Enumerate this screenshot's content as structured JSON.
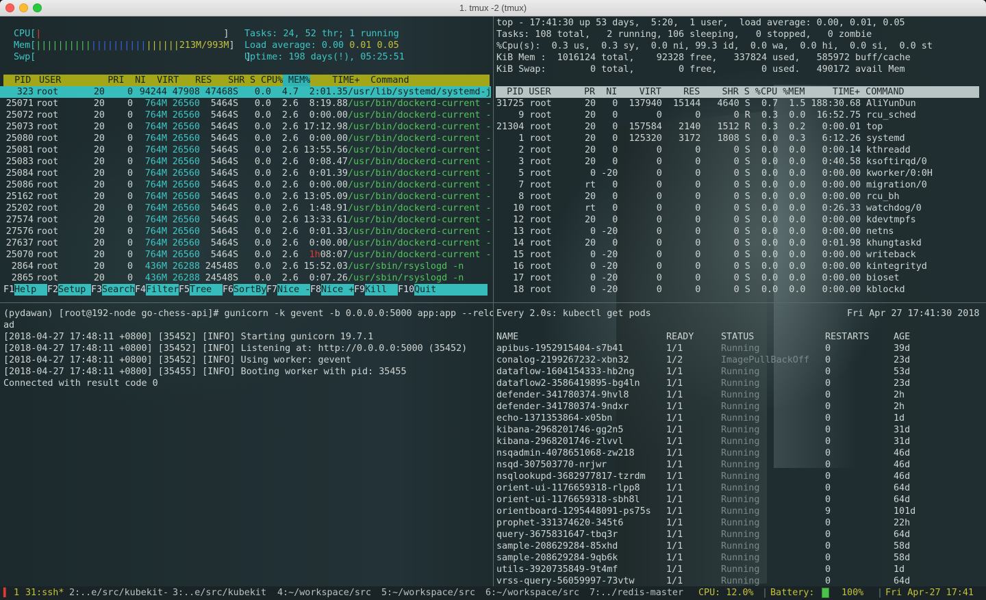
{
  "window": {
    "title": "1. tmux -2 (tmux)"
  },
  "htop": {
    "meter_cpu_label": "CPU[",
    "meter_cpu_bar": "|",
    "meter_cpu_end": "                                 ]",
    "meter_mem_label": "Mem[",
    "meter_mem_bar1": "||||||||||",
    "meter_mem_bar2": "||||||||||",
    "meter_mem_bar3": "||||||",
    "meter_mem_value": "213M/993M",
    "meter_mem_end": "]",
    "meter_swp_label": "Swp[",
    "meter_swp_end": "                                      ]",
    "tasks_label": "Tasks: ",
    "tasks_value": "24, 52 thr; 1 running",
    "load_label": "Load average: ",
    "load_1": "0.00",
    "load_5": "0.01",
    "load_15": "0.05",
    "uptime_label": "Uptime: ",
    "uptime_value": "198 days(!), 05:25:51",
    "columns": [
      {
        "text": "  PID",
        "w": 44
      },
      {
        "text": " USER",
        "w": 60
      },
      {
        "text": "      PRI",
        "w": 72
      },
      {
        "text": "  NI",
        "w": 32
      },
      {
        "text": "  VIRT",
        "w": 48
      },
      {
        "text": "   RES",
        "w": 48
      },
      {
        "text": "   SHR",
        "w": 48
      },
      {
        "text": " S",
        "w": 16
      },
      {
        "text": " CPU%",
        "w": 40
      },
      {
        "text": " MEM%",
        "w": 40
      },
      {
        "text": "    TIME+",
        "w": 72
      },
      {
        "text": "  Command",
        "w": 190
      }
    ],
    "rows": [
      {
        "pid": "  323",
        "user": "root",
        "pri": "20",
        "ni": "0",
        "virt": "94244",
        "res": "47908",
        "shr": "47468",
        "s": "S",
        "cpu": "0.0",
        "mem": "4.7",
        "time_h": "",
        "time": "2:01.35",
        "cmd": "/usr/lib/systemd/systemd-j",
        "sel": true
      },
      {
        "pid": "25071",
        "user": "root",
        "pri": "20",
        "ni": "0",
        "virt": "764M",
        "res": "26560",
        "shr": "5464",
        "s": "S",
        "cpu": "0.0",
        "mem": "2.6",
        "time_h": "",
        "time": "8:19.88",
        "cmd": "/usr/bin/dockerd-current -"
      },
      {
        "pid": "25072",
        "user": "root",
        "pri": "20",
        "ni": "0",
        "virt": "764M",
        "res": "26560",
        "shr": "5464",
        "s": "S",
        "cpu": "0.0",
        "mem": "2.6",
        "time_h": "",
        "time": "0:00.00",
        "cmd": "/usr/bin/dockerd-current -"
      },
      {
        "pid": "25073",
        "user": "root",
        "pri": "20",
        "ni": "0",
        "virt": "764M",
        "res": "26560",
        "shr": "5464",
        "s": "S",
        "cpu": "0.0",
        "mem": "2.6",
        "time_h": "",
        "time": "17:12.98",
        "cmd": "/usr/bin/dockerd-current -"
      },
      {
        "pid": "25080",
        "user": "root",
        "pri": "20",
        "ni": "0",
        "virt": "764M",
        "res": "26560",
        "shr": "5464",
        "s": "S",
        "cpu": "0.0",
        "mem": "2.6",
        "time_h": "",
        "time": "0:00.00",
        "cmd": "/usr/bin/dockerd-current -"
      },
      {
        "pid": "25081",
        "user": "root",
        "pri": "20",
        "ni": "0",
        "virt": "764M",
        "res": "26560",
        "shr": "5464",
        "s": "S",
        "cpu": "0.0",
        "mem": "2.6",
        "time_h": "",
        "time": "13:55.56",
        "cmd": "/usr/bin/dockerd-current -"
      },
      {
        "pid": "25083",
        "user": "root",
        "pri": "20",
        "ni": "0",
        "virt": "764M",
        "res": "26560",
        "shr": "5464",
        "s": "S",
        "cpu": "0.0",
        "mem": "2.6",
        "time_h": "",
        "time": "0:08.47",
        "cmd": "/usr/bin/dockerd-current -"
      },
      {
        "pid": "25084",
        "user": "root",
        "pri": "20",
        "ni": "0",
        "virt": "764M",
        "res": "26560",
        "shr": "5464",
        "s": "S",
        "cpu": "0.0",
        "mem": "2.6",
        "time_h": "",
        "time": "0:01.39",
        "cmd": "/usr/bin/dockerd-current -"
      },
      {
        "pid": "25086",
        "user": "root",
        "pri": "20",
        "ni": "0",
        "virt": "764M",
        "res": "26560",
        "shr": "5464",
        "s": "S",
        "cpu": "0.0",
        "mem": "2.6",
        "time_h": "",
        "time": "0:00.00",
        "cmd": "/usr/bin/dockerd-current -"
      },
      {
        "pid": "25162",
        "user": "root",
        "pri": "20",
        "ni": "0",
        "virt": "764M",
        "res": "26560",
        "shr": "5464",
        "s": "S",
        "cpu": "0.0",
        "mem": "2.6",
        "time_h": "",
        "time": "13:05.09",
        "cmd": "/usr/bin/dockerd-current -"
      },
      {
        "pid": "25202",
        "user": "root",
        "pri": "20",
        "ni": "0",
        "virt": "764M",
        "res": "26560",
        "shr": "5464",
        "s": "S",
        "cpu": "0.0",
        "mem": "2.6",
        "time_h": "",
        "time": "1:48.91",
        "cmd": "/usr/bin/dockerd-current -"
      },
      {
        "pid": "27574",
        "user": "root",
        "pri": "20",
        "ni": "0",
        "virt": "764M",
        "res": "26560",
        "shr": "5464",
        "s": "S",
        "cpu": "0.0",
        "mem": "2.6",
        "time_h": "",
        "time": "13:33.61",
        "cmd": "/usr/bin/dockerd-current -"
      },
      {
        "pid": "27576",
        "user": "root",
        "pri": "20",
        "ni": "0",
        "virt": "764M",
        "res": "26560",
        "shr": "5464",
        "s": "S",
        "cpu": "0.0",
        "mem": "2.6",
        "time_h": "",
        "time": "0:01.33",
        "cmd": "/usr/bin/dockerd-current -"
      },
      {
        "pid": "27637",
        "user": "root",
        "pri": "20",
        "ni": "0",
        "virt": "764M",
        "res": "26560",
        "shr": "5464",
        "s": "S",
        "cpu": "0.0",
        "mem": "2.6",
        "time_h": "",
        "time": "0:00.00",
        "cmd": "/usr/bin/dockerd-current -"
      },
      {
        "pid": "25070",
        "user": "root",
        "pri": "20",
        "ni": "0",
        "virt": "764M",
        "res": "26560",
        "shr": "5464",
        "s": "S",
        "cpu": "0.0",
        "mem": "2.6",
        "time_h": "1h",
        "time": "08:07",
        "cmd": "/usr/bin/dockerd-current -"
      },
      {
        "pid": " 2864",
        "user": "root",
        "pri": "20",
        "ni": "0",
        "virt": "436M",
        "res": "26288",
        "shr": "24548",
        "s": "S",
        "cpu": "0.0",
        "mem": "2.6",
        "time_h": "",
        "time": "15:52.03",
        "cmd": "/usr/sbin/rsyslogd -n"
      },
      {
        "pid": " 2865",
        "user": "root",
        "pri": "20",
        "ni": "0",
        "virt": "436M",
        "res": "26288",
        "shr": "24548",
        "s": "S",
        "cpu": "0.0",
        "mem": "2.6",
        "time_h": "",
        "time": "0:07.26",
        "cmd": "/usr/sbin/rsyslogd -n"
      }
    ],
    "fkeys": [
      {
        "key": "F1",
        "label": "Help  "
      },
      {
        "key": "F2",
        "label": "Setup "
      },
      {
        "key": "F3",
        "label": "Search"
      },
      {
        "key": "F4",
        "label": "Filter"
      },
      {
        "key": "F5",
        "label": "Tree  "
      },
      {
        "key": "F6",
        "label": "SortBy"
      },
      {
        "key": "F7",
        "label": "Nice -"
      },
      {
        "key": "F8",
        "label": "Nice +"
      },
      {
        "key": "F9",
        "label": "Kill  "
      },
      {
        "key": "F10",
        "label": "Quit"
      }
    ]
  },
  "top": {
    "summary": [
      "top - 17:41:30 up 53 days,  5:20,  1 user,  load average: 0.00, 0.01, 0.05",
      "Tasks: 108 total,   2 running, 106 sleeping,   0 stopped,   0 zombie",
      "%Cpu(s):  0.3 us,  0.3 sy,  0.0 ni, 99.3 id,  0.0 wa,  0.0 hi,  0.0 si,  0.0 st",
      "KiB Mem :  1016124 total,    92328 free,   337824 used,   585972 buff/cache",
      "KiB Swap:        0 total,        0 free,        0 used.   490172 avail Mem"
    ],
    "header": "  PID USER      PR  NI    VIRT    RES    SHR S %CPU %MEM     TIME+ COMMAND     ",
    "rows": [
      "31725 root      20   0  137940  15144   4640 S  0.7  1.5 188:30.68 AliYunDun",
      "    9 root      20   0       0      0      0 R  0.3  0.0  16:52.75 rcu_sched",
      "21304 root      20   0  157584   2140   1512 R  0.3  0.2   0:00.01 top",
      "    1 root      20   0  125320   3172   1808 S  0.0  0.3   6:12.26 systemd",
      "    2 root      20   0       0      0      0 S  0.0  0.0   0:00.14 kthreadd",
      "    3 root      20   0       0      0      0 S  0.0  0.0   0:40.58 ksoftirqd/0",
      "    5 root       0 -20       0      0      0 S  0.0  0.0   0:00.00 kworker/0:0H",
      "    7 root      rt   0       0      0      0 S  0.0  0.0   0:00.00 migration/0",
      "    8 root      20   0       0      0      0 S  0.0  0.0   0:00.00 rcu_bh",
      "   10 root      rt   0       0      0      0 S  0.0  0.0   0:26.33 watchdog/0",
      "   12 root      20   0       0      0      0 S  0.0  0.0   0:00.00 kdevtmpfs",
      "   13 root       0 -20       0      0      0 S  0.0  0.0   0:00.00 netns",
      "   14 root      20   0       0      0      0 S  0.0  0.0   0:01.98 khungtaskd",
      "   15 root       0 -20       0      0      0 S  0.0  0.0   0:00.00 writeback",
      "   16 root       0 -20       0      0      0 S  0.0  0.0   0:00.00 kintegrityd",
      "   17 root       0 -20       0      0      0 S  0.0  0.0   0:00.00 bioset",
      "   18 root       0 -20       0      0      0 S  0.0  0.0   0:00.00 kblockd"
    ]
  },
  "shell": {
    "prompt": "(pydawan) [root@192-node go-chess-api]# ",
    "command": "gunicorn -k gevent -b 0.0.0.0:5000 app:app --relo",
    "command_wrap": "ad",
    "output": [
      "[2018-04-27 17:48:11 +0800] [35452] [INFO] Starting gunicorn 19.7.1",
      "[2018-04-27 17:48:11 +0800] [35452] [INFO] Listening at: http://0.0.0.0:5000 (35452)",
      "[2018-04-27 17:48:11 +0800] [35452] [INFO] Using worker: gevent",
      "[2018-04-27 17:48:11 +0800] [35455] [INFO] Booting worker with pid: 35455",
      "Connected with result code 0"
    ]
  },
  "watch": {
    "header_left": "Every 2.0s: kubectl get pods",
    "header_right": "Fri Apr 27 17:41:30 2018",
    "columns": [
      "NAME",
      "READY",
      "STATUS",
      "RESTARTS",
      "AGE"
    ],
    "pods": [
      {
        "name": "apibus-1952915404-s7b41",
        "ready": "1/1",
        "status": "Running",
        "restarts": "0",
        "age": "39d"
      },
      {
        "name": "conalog-2199267232-xbn32",
        "ready": "1/2",
        "status": "ImagePullBackOff",
        "restarts": "0",
        "age": "23d"
      },
      {
        "name": "dataflow-1604154333-hb2ng",
        "ready": "1/1",
        "status": "Running",
        "restarts": "0",
        "age": "53d"
      },
      {
        "name": "dataflow2-3586419895-bg4ln",
        "ready": "1/1",
        "status": "Running",
        "restarts": "0",
        "age": "23d"
      },
      {
        "name": "defender-341780374-9hvl8",
        "ready": "1/1",
        "status": "Running",
        "restarts": "0",
        "age": "2h"
      },
      {
        "name": "defender-341780374-9ndxr",
        "ready": "1/1",
        "status": "Running",
        "restarts": "0",
        "age": "2h"
      },
      {
        "name": "echo-1371353864-x05bn",
        "ready": "1/1",
        "status": "Running",
        "restarts": "0",
        "age": "1d"
      },
      {
        "name": "kibana-2968201746-gg2n5",
        "ready": "1/1",
        "status": "Running",
        "restarts": "0",
        "age": "31d"
      },
      {
        "name": "kibana-2968201746-zlvvl",
        "ready": "1/1",
        "status": "Running",
        "restarts": "0",
        "age": "31d"
      },
      {
        "name": "nsqadmin-4078651068-zw218",
        "ready": "1/1",
        "status": "Running",
        "restarts": "0",
        "age": "46d"
      },
      {
        "name": "nsqd-307503770-nrjwr",
        "ready": "1/1",
        "status": "Running",
        "restarts": "0",
        "age": "46d"
      },
      {
        "name": "nsqlookupd-3682977817-tzrdm",
        "ready": "1/1",
        "status": "Running",
        "restarts": "0",
        "age": "46d"
      },
      {
        "name": "orient-ui-1176659318-rlpp8",
        "ready": "1/1",
        "status": "Running",
        "restarts": "0",
        "age": "64d"
      },
      {
        "name": "orient-ui-1176659318-sbh8l",
        "ready": "1/1",
        "status": "Running",
        "restarts": "0",
        "age": "64d"
      },
      {
        "name": "orientboard-1295448091-ps75s",
        "ready": "1/1",
        "status": "Running",
        "restarts": "9",
        "age": "101d"
      },
      {
        "name": "prophet-331374620-345t6",
        "ready": "1/1",
        "status": "Running",
        "restarts": "0",
        "age": "22h"
      },
      {
        "name": "query-3675831647-tbq3r",
        "ready": "1/1",
        "status": "Running",
        "restarts": "0",
        "age": "64d"
      },
      {
        "name": "sample-208629284-85xhd",
        "ready": "1/1",
        "status": "Running",
        "restarts": "0",
        "age": "58d"
      },
      {
        "name": "sample-208629284-9qb6k",
        "ready": "1/1",
        "status": "Running",
        "restarts": "0",
        "age": "58d"
      },
      {
        "name": "utils-3920735849-9t4mf",
        "ready": "1/1",
        "status": "Running",
        "restarts": "0",
        "age": "1d"
      },
      {
        "name": "vrss-query-56059997-73vtw",
        "ready": "1/1",
        "status": "Running",
        "restarts": "0",
        "age": "64d"
      }
    ]
  },
  "tmux": {
    "session": "1",
    "windows": [
      {
        "label": "31:ssh*",
        "active": true
      },
      {
        "label": "2:..e/src/kubekit-"
      },
      {
        "label": "3:..e/src/kubekit"
      },
      {
        "label": "4:~/workspace/src"
      },
      {
        "label": "5:~/workspace/src"
      },
      {
        "label": "6:~/workspace/src"
      },
      {
        "label": "7:../redis-master"
      }
    ],
    "cpu": "CPU: 12.0%",
    "battery_label": "Battery:",
    "battery_pct": "100%",
    "datetime": "Fri Apr-27 17:41"
  },
  "colors": {
    "cyan": "#3ec6c6",
    "green": "#52c45a",
    "yellow": "#c3c33b",
    "header_bar": "#a3a619",
    "selection": "#37bcbc",
    "red": "#e03a34"
  }
}
